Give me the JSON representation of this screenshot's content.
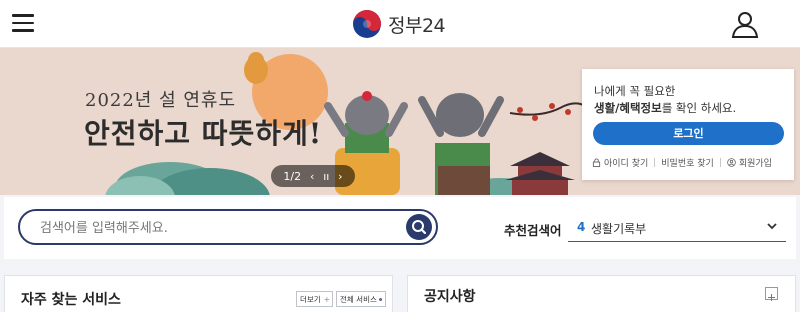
{
  "header": {
    "logo_text": "정부24",
    "menu_icon": "hamburger-icon",
    "user_icon": "user-icon"
  },
  "banner": {
    "subtitle": "2022년 설 연휴도",
    "title": "안전하고 따뜻하게!",
    "pager": {
      "current": "1",
      "separator": "/",
      "total": "2",
      "prev": "‹",
      "pause": "ıı",
      "next": "›"
    }
  },
  "login": {
    "line1": "나에게 꼭 필요한",
    "line2_bold": "생활/혜택정보",
    "line2_rest": "를 확인 하세요.",
    "button": "로그인",
    "links": [
      "아이디 찾기",
      "비밀번호 찾기",
      "회원가입"
    ]
  },
  "search": {
    "placeholder": "검색어를 입력해주세요.",
    "value": "",
    "recommend_label": "추천검색어",
    "recommend_number": "4",
    "recommend_text": "생활기록부"
  },
  "panels": {
    "frequent": {
      "title": "자주 찾는 서비스",
      "more_label": "더보기",
      "all_label": "전체 서비스"
    },
    "notice": {
      "title": "공지사항"
    }
  },
  "colors": {
    "brand_blue": "#1f70c8",
    "search_navy": "#2a3a6b",
    "banner_bg": "#ead7cd"
  }
}
